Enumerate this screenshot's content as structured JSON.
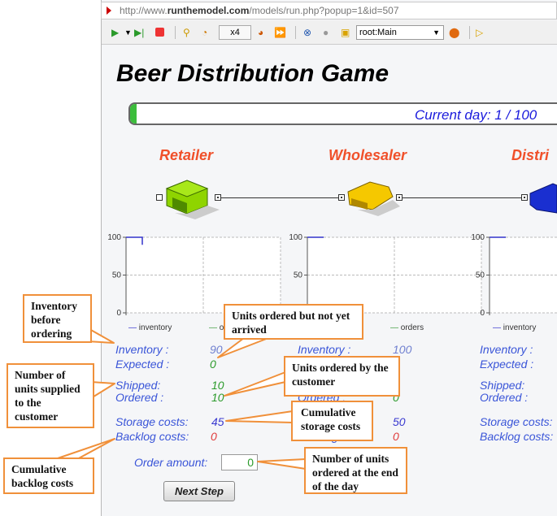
{
  "browser": {
    "url_prefix": "http://www.",
    "url_domain": "runthemodel.com",
    "url_path": "/models/run.php?popup=1&id=507"
  },
  "toolbar": {
    "speed": "x4",
    "agent": "root:Main",
    "icons": [
      "run-icon",
      "step-icon",
      "stop-icon",
      "reset-time-icon",
      "real-time-icon",
      "speed-up-icon",
      "fast-forward-icon",
      "experiment-icon",
      "record-icon",
      "navigate-up-icon",
      "location-icon",
      "console-icon"
    ]
  },
  "title": "Beer Distribution Game",
  "progress": {
    "label": "Current day: 1 / 100",
    "current": 1,
    "total": 100,
    "color": "#3cbd3c"
  },
  "roles": [
    {
      "name": "Retailer",
      "color": "#8fd400",
      "inventory": "90",
      "expected": "0",
      "shipped": "10",
      "ordered": "10",
      "storage": "45",
      "backlog": "0",
      "legend": [
        "inventory",
        "orders"
      ]
    },
    {
      "name": "Wholesaler",
      "color": "#f5c800",
      "inventory": "100",
      "ordered": "0",
      "storage": "50",
      "backlog": "0",
      "legend": [
        "orders"
      ]
    },
    {
      "name": "Distri",
      "color": "#1a2fd0",
      "legend": [
        "inventory"
      ]
    }
  ],
  "labels": {
    "inventory": "Inventory :",
    "expected": "Expected :",
    "shipped": "Shipped:",
    "ordered": "Ordered :",
    "storage": "Storage costs:",
    "backlog": "Backlog costs:"
  },
  "chart_ticks": [
    "100",
    "50",
    "0"
  ],
  "chart_data": [
    {
      "type": "line",
      "ylim": [
        0,
        100
      ],
      "grid": true,
      "legend": "bottom",
      "series": [
        {
          "name": "inventory",
          "x": [
            0,
            1,
            1
          ],
          "y": [
            100,
            100,
            90
          ],
          "color": "#3333cc"
        }
      ]
    },
    {
      "type": "line",
      "ylim": [
        0,
        100
      ],
      "grid": true,
      "legend": "bottom",
      "series": [
        {
          "name": "inventory",
          "x": [
            0,
            1
          ],
          "y": [
            100,
            100
          ],
          "color": "#3333cc"
        }
      ]
    },
    {
      "type": "line",
      "ylim": [
        0,
        100
      ],
      "grid": true,
      "legend": "bottom",
      "series": [
        {
          "name": "inventory",
          "x": [
            0,
            1
          ],
          "y": [
            100,
            100
          ],
          "color": "#3333cc"
        }
      ]
    }
  ],
  "order": {
    "label": "Order amount:",
    "value": "0"
  },
  "next_step": "Next Step",
  "callouts": {
    "inventory": "Inventory before ordering",
    "expected": "Units ordered but not yet arrived",
    "shipped": "Number of units supplied to the customer",
    "ordered": "Units ordered by the customer",
    "storage": "Cumulative storage costs",
    "backlog": "Cumulative backlog costs",
    "order": "Number of units ordered at the end of the day"
  }
}
